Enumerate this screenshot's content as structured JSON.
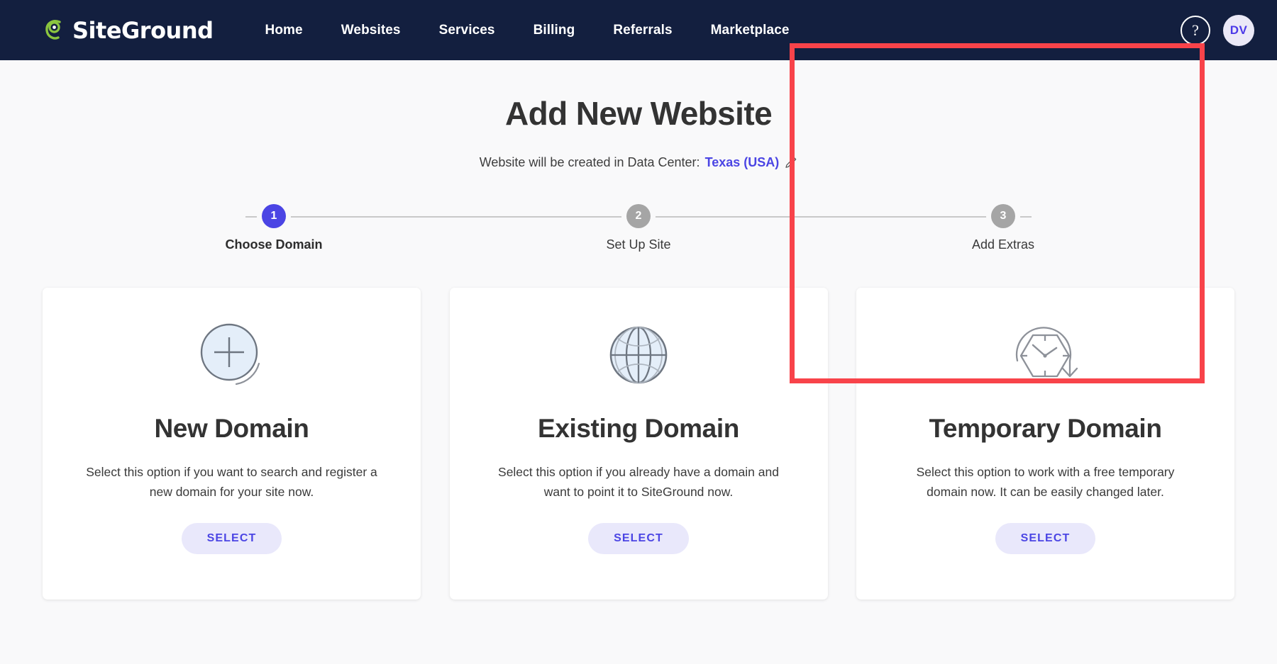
{
  "topnav": {
    "brand": {
      "name": "SiteGround",
      "logo_icon": "siteground-spiral-logo",
      "accent": "#8bc53f"
    },
    "links": [
      {
        "label": "Home"
      },
      {
        "label": "Websites"
      },
      {
        "label": "Services"
      },
      {
        "label": "Billing"
      },
      {
        "label": "Referrals"
      },
      {
        "label": "Marketplace"
      }
    ],
    "help": {
      "icon": "question-mark-icon",
      "label": "?"
    },
    "avatar": {
      "initials": "DV",
      "bg": "#ebe9f7",
      "color": "#4b39e8"
    },
    "bg": "#131f3f"
  },
  "page": {
    "title": "Add New Website",
    "subtitle_prefix": "Website will be created in Data Center:",
    "data_center": "Texas (USA)",
    "edit_icon": "pencil-icon"
  },
  "stepper": {
    "steps": [
      {
        "number": "1",
        "label": "Choose Domain",
        "state": "active"
      },
      {
        "number": "2",
        "label": "Set Up Site",
        "state": "inactive"
      },
      {
        "number": "3",
        "label": "Add Extras",
        "state": "inactive"
      }
    ],
    "active_color": "#4b45e4",
    "inactive_color": "#a5a5a5"
  },
  "cards": [
    {
      "icon": "plus-circle-icon",
      "title": "New Domain",
      "description": "Select this option if you want to search and register a new domain for your site now.",
      "button_label": "SELECT"
    },
    {
      "icon": "globe-icon",
      "title": "Existing Domain",
      "description": "Select this option if you already have a domain and want to point it to SiteGround now.",
      "button_label": "SELECT"
    },
    {
      "icon": "temporary-clock-icon",
      "title": "Temporary Domain",
      "description": "Select this option to work with a free temporary domain now. It can be easily changed later.",
      "button_label": "SELECT"
    }
  ],
  "annotation": {
    "highlight_color": "#f8434a",
    "target": "Temporary Domain"
  }
}
